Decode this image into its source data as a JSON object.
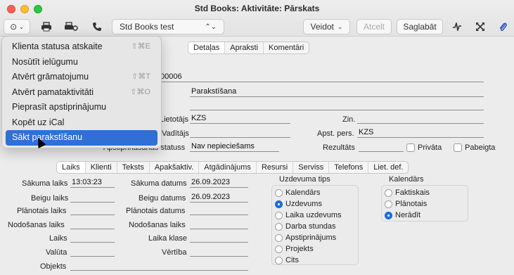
{
  "window": {
    "title": "Std Books: Aktivitāte: Pārskats"
  },
  "toolbar": {
    "company": "Std Books test",
    "create_label": "Veidot",
    "cancel_label": "Atcelt",
    "save_label": "Saglabāt"
  },
  "top_tabs": [
    "Detaļas",
    "Apraksti",
    "Komentāri"
  ],
  "header_fields": {
    "number_fragment": "00006",
    "description": "Parakstīšana",
    "user_label": "Lietotājs",
    "user_value": "KZS",
    "leader_label": "Vadītājs",
    "approval_status_label": "Apstiprināšanas statuss",
    "approval_status_value": "Nav nepieciešams",
    "zin_label": "Zin.",
    "apst_pers_label": "Apst. pers.",
    "apst_pers_value": "KZS",
    "result_label": "Rezultāts",
    "private_label": "Privāta",
    "finish_label": "Pabeigta"
  },
  "lower_tabs": [
    "Laiks",
    "Klienti",
    "Teksts",
    "Apakšaktiv.",
    "Atgādinājums",
    "Resursi",
    "Serviss",
    "Telefons",
    "Liet. def."
  ],
  "time_fields": {
    "start_time_label": "Sākuma laiks",
    "start_time_value": "13:03:23",
    "end_time_label": "Beigu laiks",
    "planned_time_label": "Plānotais laiks",
    "handover_time_label": "Nodošanas laiks",
    "laiks_label": "Laiks",
    "currency_label": "Valūta",
    "objects_label": "Objekts",
    "start_date_label": "Sākuma datums",
    "start_date_value": "26.09.2023",
    "end_date_label": "Beigu datums",
    "end_date_value": "26.09.2023",
    "planned_date_label": "Plānotais datums",
    "handover_date_label": "Nodošanas laiks",
    "time_class_label": "Laika klase",
    "value_label": "Vērtība"
  },
  "task_type": {
    "title": "Uzdevuma tips",
    "options": [
      "Kalendārs",
      "Uzdevums",
      "Laika uzdevums",
      "Darba stundas",
      "Apstiprinājums",
      "Projekts",
      "Cits"
    ],
    "selected": 1
  },
  "calendar": {
    "title": "Kalendārs",
    "options": [
      "Faktiskais",
      "Plānotais",
      "Nerādīt"
    ],
    "selected": 2
  },
  "menu": {
    "items": [
      {
        "label": "Klienta statusa atskaite",
        "shortcut": "⇧⌘E"
      },
      {
        "label": "Nosūtīt ielūgumu",
        "shortcut": ""
      },
      {
        "label": "Atvērt grāmatojumu",
        "shortcut": "⇧⌘T"
      },
      {
        "label": "Atvērt pamataktivitāti",
        "shortcut": "⇧⌘O"
      },
      {
        "label": "Pieprasīt apstiprinājumu",
        "shortcut": ""
      },
      {
        "label": "Kopēt uz iCal",
        "shortcut": ""
      },
      {
        "label": "Sākt parakstīšanu",
        "shortcut": ""
      }
    ],
    "highlighted": 6
  },
  "icons": {
    "more": "ellipsis-circle-icon",
    "print": "printer-icon",
    "print_setup": "print-setup-icon",
    "phone": "phone-icon",
    "chart": "activity-chart-icon",
    "expand": "expand-icon",
    "attach": "paperclip-icon"
  },
  "colors": {
    "highlight": "#2f6fd6",
    "radio_on": "#1a73e8"
  }
}
